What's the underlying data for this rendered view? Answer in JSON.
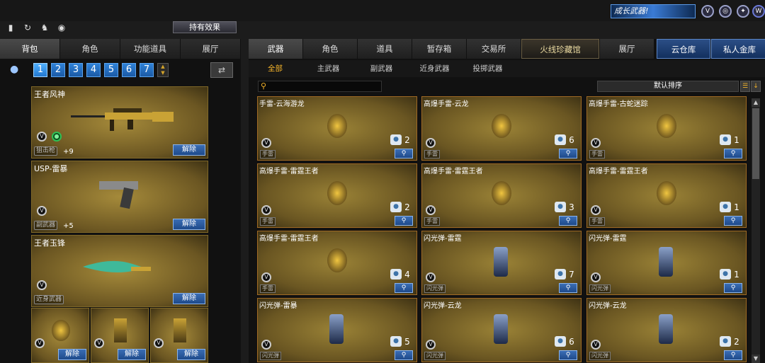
{
  "header": {
    "equipped_effect_label": "持有效果",
    "growth_weapon_label": "成长武器!",
    "top_icons": [
      "rank-icon",
      "refresh-icon",
      "unicorn-icon",
      "egg-icon"
    ]
  },
  "left_tabs": [
    "背包",
    "角色",
    "功能道具",
    "展厅"
  ],
  "pages": [
    "1",
    "2",
    "3",
    "4",
    "5",
    "6",
    "7"
  ],
  "equipped": [
    {
      "name": "王者风神",
      "tag": "狙击枪",
      "level": "+9",
      "action": "解除"
    },
    {
      "name": "USP-雷暴",
      "tag": "副武器",
      "level": "+5",
      "action": "解除"
    },
    {
      "name": "王者玉锋",
      "tag": "近身武器",
      "level": "",
      "action": "解除"
    }
  ],
  "small_slots": [
    {
      "action": "解除"
    },
    {
      "action": "解除"
    },
    {
      "action": "解除"
    }
  ],
  "right_tabs": [
    "武器",
    "角色",
    "道具",
    "暂存箱",
    "交易所",
    "火线珍藏馆",
    "展厅",
    "云仓库",
    "私人金库"
  ],
  "sub_tabs": [
    "全部",
    "主武器",
    "副武器",
    "近身武器",
    "投掷武器"
  ],
  "sort_label": "默认排序",
  "items": [
    {
      "name": "手雷-云海游龙",
      "count": "2",
      "tag": "手雷"
    },
    {
      "name": "高爆手雷-云龙",
      "count": "6",
      "tag": "手雷"
    },
    {
      "name": "高爆手雷-古蛇迷踪",
      "count": "1",
      "tag": "手雷"
    },
    {
      "name": "高爆手雷-雷霆王者",
      "count": "2",
      "tag": "手雷"
    },
    {
      "name": "高爆手雷-雷霆王者",
      "count": "3",
      "tag": "手雷"
    },
    {
      "name": "高爆手雷-雷霆王者",
      "count": "1",
      "tag": "手雷"
    },
    {
      "name": "高爆手雷-雷霆王者",
      "count": "4",
      "tag": "手雷"
    },
    {
      "name": "闪光弹-雷霆",
      "count": "7",
      "tag": "闪光弹"
    },
    {
      "name": "闪光弹-雷霆",
      "count": "1",
      "tag": "闪光弹"
    },
    {
      "name": "闪光弹-雷暴",
      "count": "5",
      "tag": "闪光弹"
    },
    {
      "name": "闪光弹-云龙",
      "count": "6",
      "tag": "闪光弹"
    },
    {
      "name": "闪光弹-云龙",
      "count": "2",
      "tag": "闪光弹"
    }
  ],
  "accent_colors": {
    "gold": "#f3b32a",
    "blue_button": "#1e4a8a",
    "card_border": "#a06a24"
  }
}
